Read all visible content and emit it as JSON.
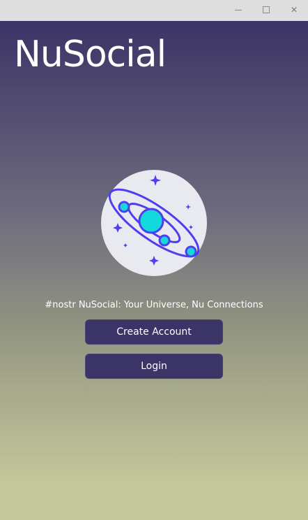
{
  "window": {
    "controls": {
      "minimize_icon": "minimize-icon",
      "maximize_icon": "maximize-icon",
      "close_icon": "close-icon",
      "close_glyph": "✕"
    }
  },
  "app": {
    "title": "NuSocial",
    "tagline": "#nostr NuSocial: Your Universe, Nu Connections"
  },
  "actions": {
    "create_account_label": "Create Account",
    "login_label": "Login"
  },
  "colors": {
    "gradient_top": "#3c3466",
    "gradient_bottom": "#c4c89a",
    "button_bg": "#3b3466",
    "logo_bg": "#e9eaf0",
    "logo_stroke": "#4f3ef0",
    "planet_fill": "#14d9dc"
  }
}
